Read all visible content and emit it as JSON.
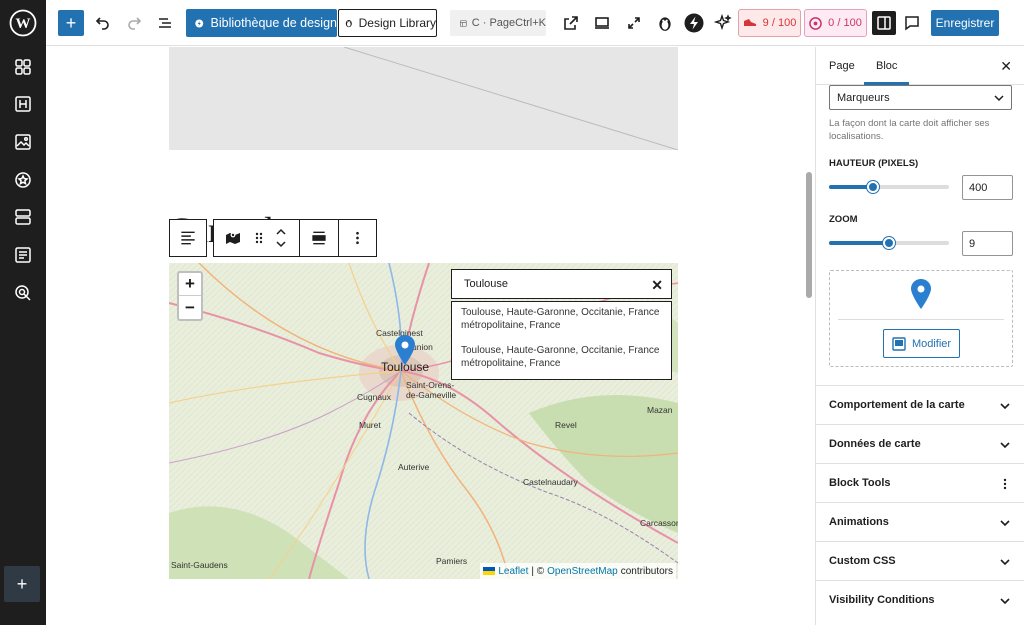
{
  "toolbar": {
    "library_button": "Bibliothèque de design",
    "design_library": "Design Library",
    "command_palette": "C · PageCtrl+K",
    "badge_a": "9 / 100",
    "badge_b": "0 / 100",
    "save": "Enregistrer"
  },
  "colors": {
    "accent": "#2271b1",
    "rail": "#1e1e1e",
    "badge_red": "#d63638",
    "badge_pink": "#c9356e",
    "marker": "#2b7fd0"
  },
  "canvas": {
    "heading": "Carte du"
  },
  "map": {
    "search_query": "Toulouse",
    "results": [
      "Toulouse, Haute-Garonne, Occitanie, France métropolitaine, France",
      "Toulouse, Haute-Garonne, Occitanie, France métropolitaine, France"
    ],
    "places": {
      "castelginest": "Castelginest",
      "balma": "Balma",
      "toulouse": "Toulouse",
      "saint_orens": "Saint-Orens-",
      "gameville": "de-Gameville",
      "cugnaux": "Cugnaux",
      "muret": "Muret",
      "revel": "Revel",
      "mazamet": "Mazan",
      "auterive": "Auterive",
      "castelnaudary": "Castelnaudary",
      "carcassonne": "Carcasson",
      "saint_gaudens": "Saint-Gaudens",
      "pamiers": "Pamiers",
      "union": "union"
    },
    "attribution": {
      "leaflet": "Leaflet",
      "separator": "| ©",
      "osm": "OpenStreetMap",
      "contributors": "contributors"
    }
  },
  "inspector": {
    "tab_page": "Page",
    "tab_block": "Bloc",
    "display_select": "Marqueurs",
    "display_help": "La façon dont la carte doit afficher ses localisations.",
    "height_label": "HAUTEUR (PIXELS)",
    "height_value": "400",
    "height_fraction": 0.37,
    "zoom_label": "ZOOM",
    "zoom_value": "9",
    "zoom_fraction": 0.5,
    "modify_button": "Modifier",
    "panels": [
      "Comportement de la carte",
      "Données de carte",
      "Block Tools",
      "Animations",
      "Custom CSS",
      "Visibility Conditions"
    ]
  }
}
